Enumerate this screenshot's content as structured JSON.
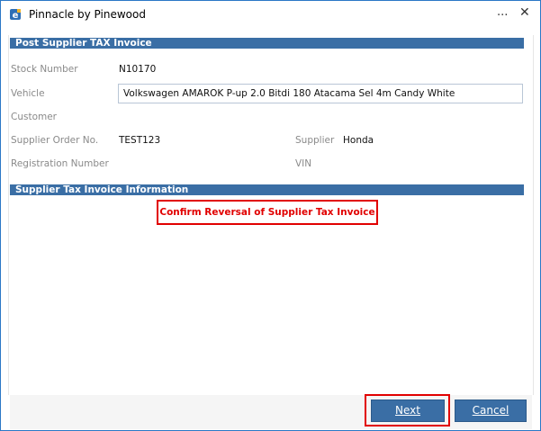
{
  "window": {
    "title": "Pinnacle by Pinewood",
    "more_glyph": "...",
    "close_glyph": "✕"
  },
  "sections": {
    "post_invoice": "Post Supplier TAX Invoice",
    "invoice_info": "Supplier Tax Invoice Information"
  },
  "fields": {
    "stock_number_label": "Stock Number",
    "stock_number_value": "N10170",
    "vehicle_label": "Vehicle",
    "vehicle_value": "Volkswagen AMAROK P-up 2.0 Bitdi 180 Atacama Sel 4m Candy White",
    "customer_label": "Customer",
    "supplier_order_label": "Supplier Order No.",
    "supplier_order_value": "TEST123",
    "supplier_label": "Supplier",
    "supplier_value": "Honda",
    "registration_label": "Registration Number",
    "vin_label": "VIN"
  },
  "confirm_text": "Confirm Reversal of Supplier Tax Invoice",
  "buttons": {
    "next": "Next",
    "cancel": "Cancel"
  },
  "colors": {
    "section_bar": "#3a6ea5",
    "highlight": "#e10000",
    "label": "#8a8a8a"
  }
}
